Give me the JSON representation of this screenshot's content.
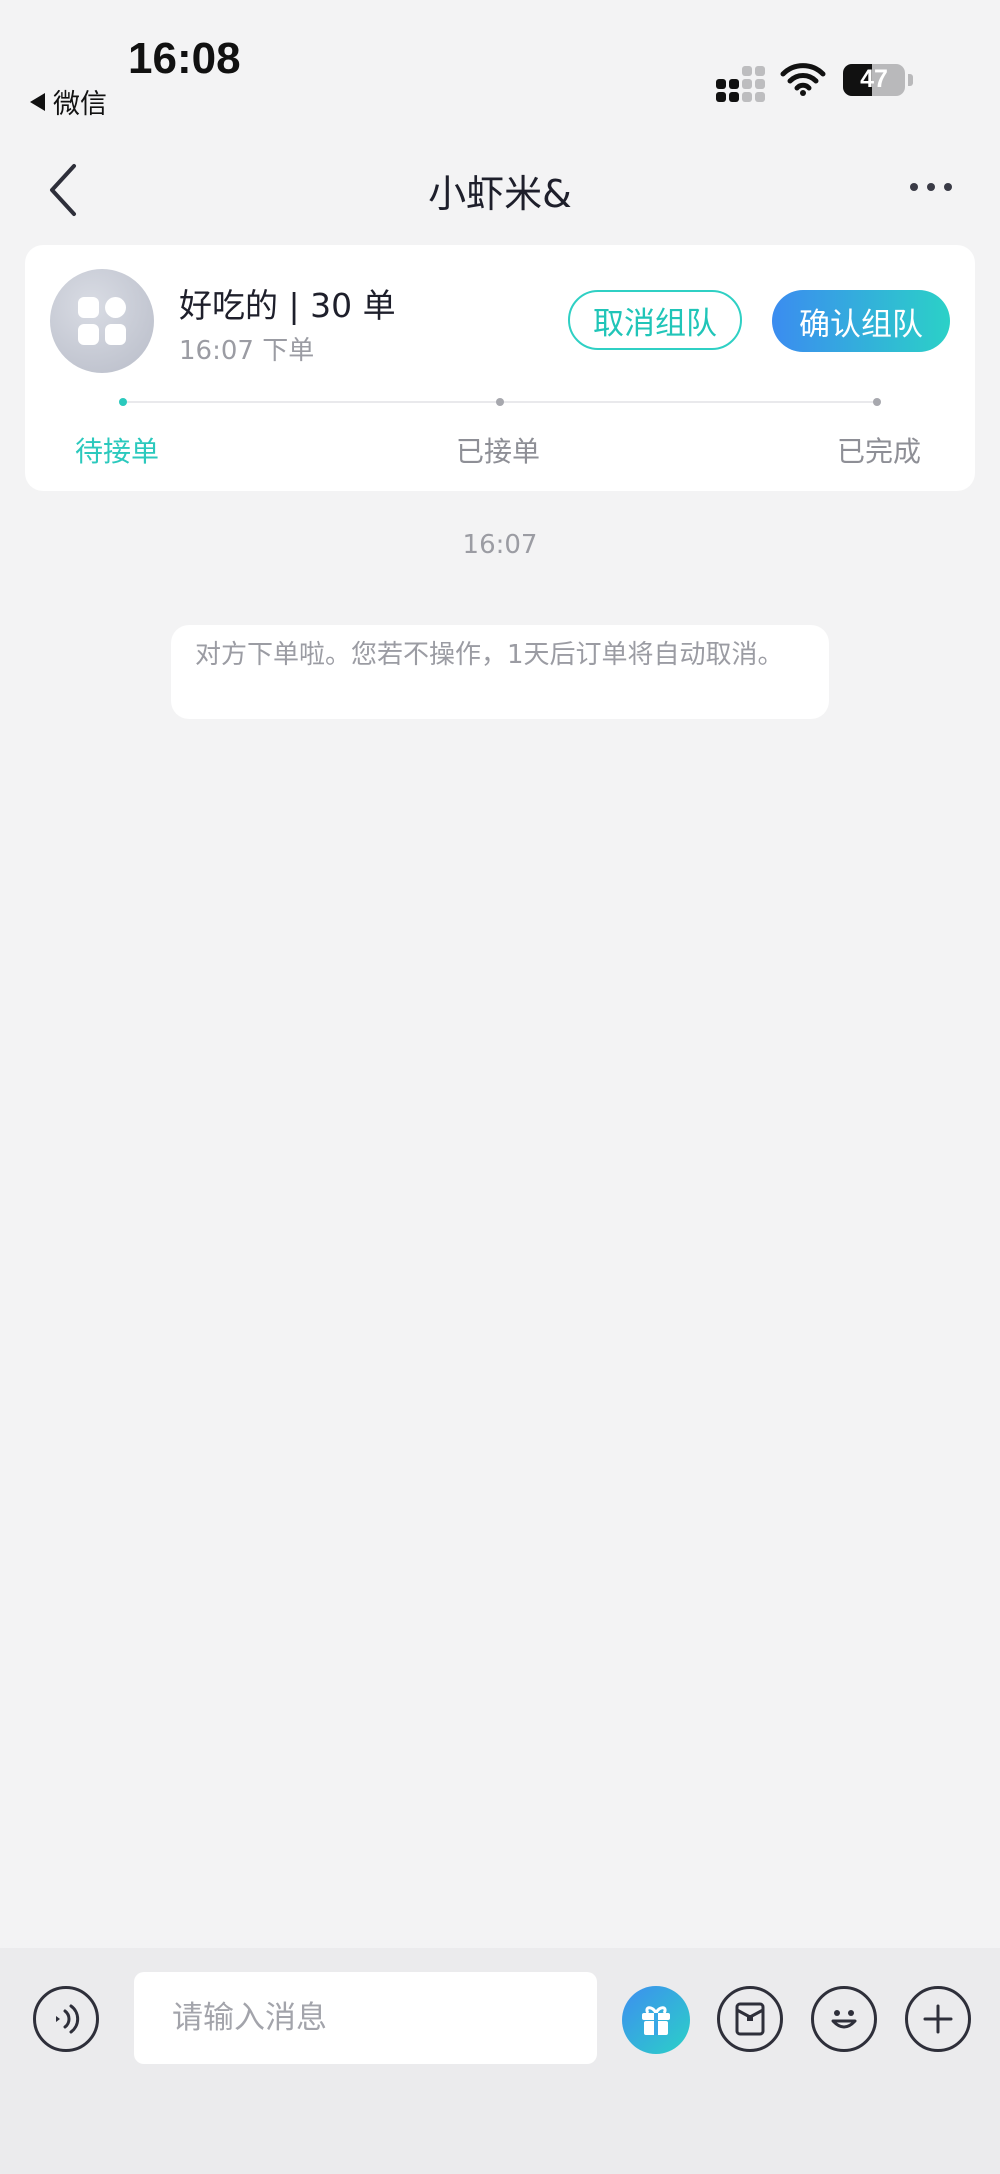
{
  "status_bar": {
    "time": "16:08",
    "back_app": "微信",
    "battery": "47",
    "battery_level_fraction": 0.47
  },
  "nav": {
    "title": "小虾米&"
  },
  "order": {
    "title": "好吃的 | 30 单",
    "time": "16:07 下单",
    "cancel_label": "取消组队",
    "confirm_label": "确认组队",
    "steps": [
      "待接单",
      "已接单",
      "已完成"
    ],
    "active_step": 0
  },
  "chat": {
    "time": "16:07",
    "system_message": "对方下单啦。您若不操作，1天后订单将自动取消。"
  },
  "input_bar": {
    "placeholder": "请输入消息",
    "icons": [
      "voice-icon",
      "gift-icon",
      "box-icon",
      "emoji-icon",
      "plus-icon"
    ]
  },
  "colors": {
    "accent": "#20c5b8",
    "gradient_start": "#3b8cf0",
    "gradient_end": "#2bd1c7",
    "background": "#f3f3f4"
  }
}
